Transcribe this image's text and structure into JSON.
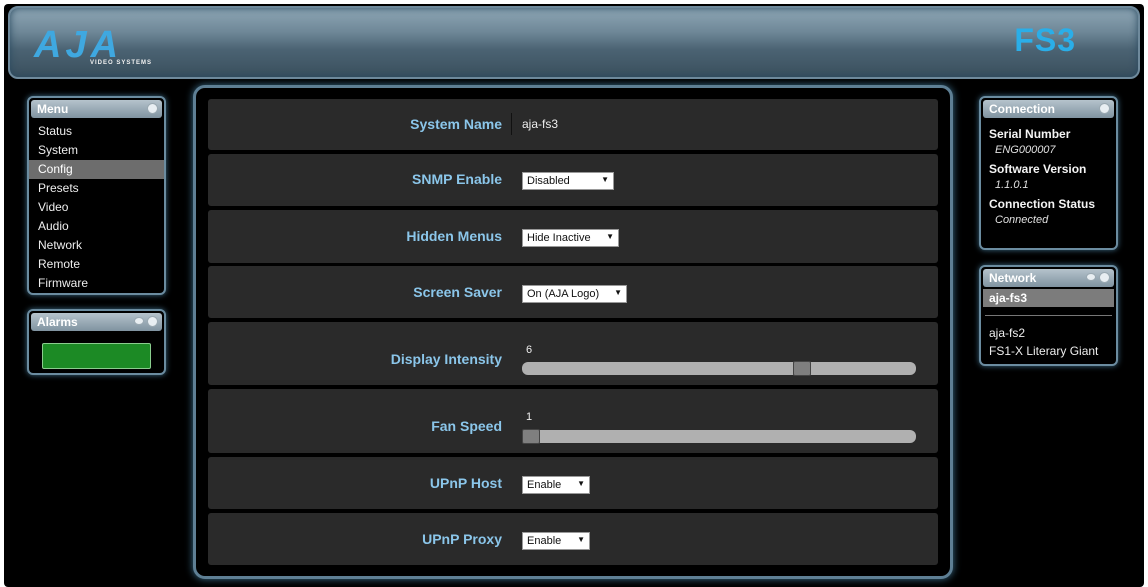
{
  "header": {
    "logo": "AJA",
    "logo_sub": "VIDEO SYSTEMS",
    "product": "FS3"
  },
  "menu": {
    "title": "Menu",
    "items": [
      {
        "label": "Status",
        "active": false
      },
      {
        "label": "System",
        "active": false
      },
      {
        "label": "Config",
        "active": true
      },
      {
        "label": "Presets",
        "active": false
      },
      {
        "label": "Video",
        "active": false
      },
      {
        "label": "Audio",
        "active": false
      },
      {
        "label": "Network",
        "active": false
      },
      {
        "label": "Remote",
        "active": false
      },
      {
        "label": "Firmware",
        "active": false
      }
    ]
  },
  "alarms": {
    "title": "Alarms",
    "status_color": "#1c8a25"
  },
  "connection": {
    "title": "Connection",
    "serial_label": "Serial Number",
    "serial_value": "ENG000007",
    "software_label": "Software Version",
    "software_value": "1.1.0.1",
    "status_label": "Connection Status",
    "status_value": "Connected"
  },
  "network": {
    "title": "Network",
    "selected": "aja-fs3",
    "items": [
      "aja-fs2",
      "FS1-X Literary Giant"
    ]
  },
  "settings": {
    "system_name": {
      "label": "System Name",
      "value": "aja-fs3"
    },
    "snmp_enable": {
      "label": "SNMP Enable",
      "value": "Disabled"
    },
    "hidden_menus": {
      "label": "Hidden Menus",
      "value": "Hide Inactive"
    },
    "screen_saver": {
      "label": "Screen Saver",
      "value": "On (AJA Logo)"
    },
    "display_intensity": {
      "label": "Display Intensity",
      "value": "6",
      "fraction": 0.72
    },
    "fan_speed": {
      "label": "Fan Speed",
      "value": "1",
      "fraction": 0.0
    },
    "upnp_host": {
      "label": "UPnP Host",
      "value": "Enable"
    },
    "upnp_proxy": {
      "label": "UPnP Proxy",
      "value": "Enable"
    }
  },
  "colors": {
    "accent": "#2aaee8",
    "label": "#8bc6ea",
    "panel_border": "#6b8ca0"
  }
}
